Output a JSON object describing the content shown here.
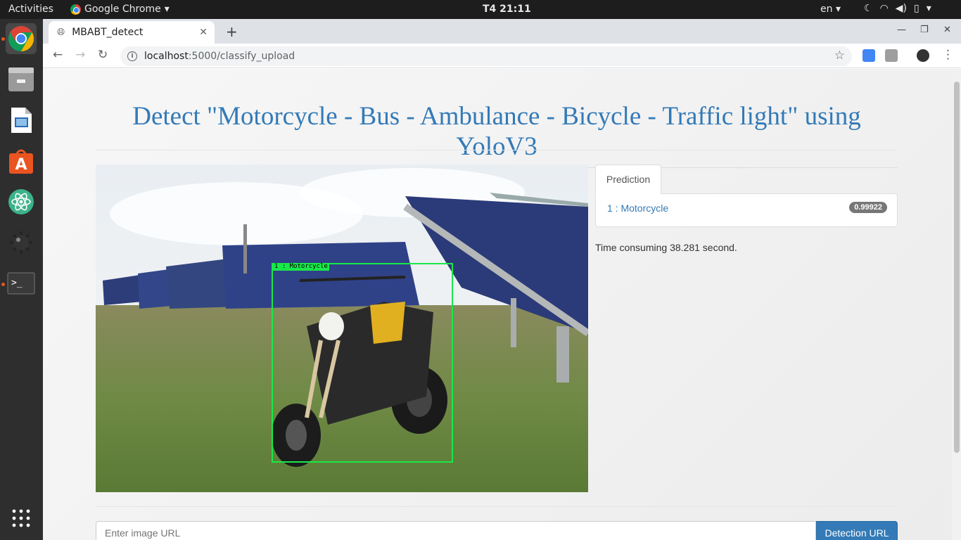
{
  "topbar": {
    "activities": "Activities",
    "app_name": "Google Chrome",
    "clock": "T4 21:11",
    "lang": "en",
    "tray_icons": [
      "night-light-icon",
      "wifi-icon",
      "volume-icon",
      "battery-icon",
      "chevron-down-icon"
    ]
  },
  "dock": {
    "items": [
      "chrome",
      "files",
      "libreoffice-impress",
      "software-center",
      "atom",
      "settings-bomb",
      "terminal",
      "show-apps"
    ]
  },
  "browser": {
    "tab_title": "MBABT_detect",
    "url_host": "localhost",
    "url_path": ":5000/classify_upload"
  },
  "page": {
    "heading": "Detect \"Motorcycle - Bus - Ambulance - Bicycle - Traffic light\" using YoloV3",
    "detection_label": "1 : Motorcycle",
    "prediction_tab": "Prediction",
    "prediction_item": "1 : Motorcycle",
    "prediction_score": "0.99922",
    "time_text": "Time consuming 38.281 second.",
    "url_placeholder": "Enter image URL",
    "detect_button": "Detection URL"
  },
  "colors": {
    "accent": "#337ab7",
    "bbox": "#19e84a",
    "ubuntu_orange": "#e95420"
  }
}
